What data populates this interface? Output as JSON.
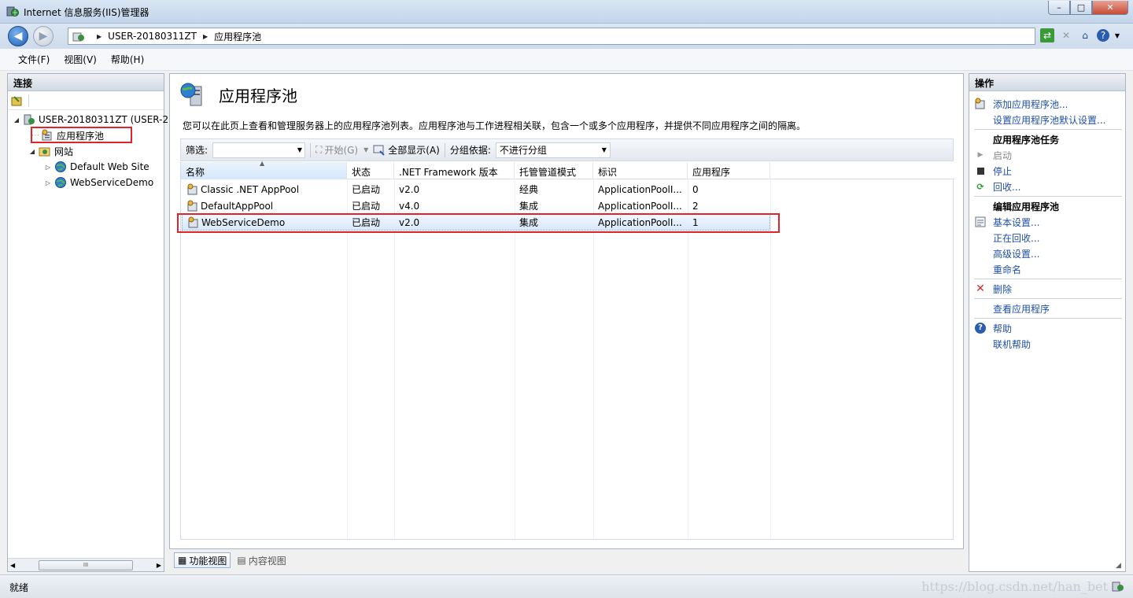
{
  "window": {
    "title": "Internet 信息服务(IIS)管理器",
    "controls": {
      "minimize": "–",
      "maximize": "□",
      "close": "✕"
    }
  },
  "address": {
    "crumbs": [
      "USER-20180311ZT",
      "应用程序池"
    ]
  },
  "menu": [
    "文件(F)",
    "视图(V)",
    "帮助(H)"
  ],
  "connections": {
    "header": "连接",
    "tree": [
      {
        "label": "USER-20180311ZT (USER-2",
        "level": 0,
        "twisty": "◢",
        "icon": "server-icon"
      },
      {
        "label": "应用程序池",
        "level": 1,
        "twisty": "",
        "icon": "app-pool-icon"
      },
      {
        "label": "网站",
        "level": 1,
        "twisty": "◢",
        "icon": "sites-folder-icon"
      },
      {
        "label": "Default Web Site",
        "level": 2,
        "twisty": "▷",
        "icon": "globe-icon"
      },
      {
        "label": "WebServiceDemo",
        "level": 2,
        "twisty": "▷",
        "icon": "globe-icon"
      }
    ],
    "scroll_left": "◀",
    "scroll_thumb": "III",
    "scroll_right": "▶"
  },
  "page": {
    "title": "应用程序池",
    "description": "您可以在此页上查看和管理服务器上的应用程序池列表。应用程序池与工作进程相关联，包含一个或多个应用程序，并提供不同应用程序之间的隔离。"
  },
  "filterbar": {
    "filter_label": "筛选:",
    "filter_value": "",
    "go_label": "开始(G)",
    "show_all_label": "全部显示(A)",
    "group_by_label": "分组依据:",
    "group_by_value": "不进行分组"
  },
  "grid": {
    "columns": [
      "名称",
      "状态",
      ".NET Framework 版本",
      "托管管道模式",
      "标识",
      "应用程序"
    ],
    "rows": [
      [
        "Classic .NET AppPool",
        "已启动",
        "v2.0",
        "经典",
        "ApplicationPoolI...",
        "0"
      ],
      [
        "DefaultAppPool",
        "已启动",
        "v4.0",
        "集成",
        "ApplicationPoolI...",
        "2"
      ],
      [
        "WebServiceDemo",
        "已启动",
        "v2.0",
        "集成",
        "ApplicationPoolI...",
        "1"
      ]
    ],
    "selected_row": 2
  },
  "view_tabs": [
    "功能视图",
    "内容视图"
  ],
  "actions": {
    "header": "操作",
    "items": [
      {
        "type": "link",
        "label": "添加应用程序池...",
        "icon": "add-pool-icon"
      },
      {
        "type": "link",
        "label": "设置应用程序池默认设置...",
        "icon": ""
      },
      {
        "type": "heading",
        "label": "应用程序池任务"
      },
      {
        "type": "disabled",
        "label": "启动",
        "icon": "play-icon"
      },
      {
        "type": "link",
        "label": "停止",
        "icon": "stop-icon"
      },
      {
        "type": "link",
        "label": "回收...",
        "icon": "recycle-icon"
      },
      {
        "type": "heading",
        "label": "编辑应用程序池"
      },
      {
        "type": "link",
        "label": "基本设置...",
        "icon": "settings-icon"
      },
      {
        "type": "link",
        "label": "正在回收...",
        "icon": ""
      },
      {
        "type": "link",
        "label": "高级设置...",
        "icon": ""
      },
      {
        "type": "link",
        "label": "重命名",
        "icon": ""
      },
      {
        "type": "link",
        "label": "删除",
        "icon": "delete-icon"
      },
      {
        "type": "link",
        "label": "查看应用程序",
        "icon": ""
      },
      {
        "type": "link",
        "label": "帮助",
        "icon": "help-icon"
      },
      {
        "type": "link",
        "label": "联机帮助",
        "icon": ""
      }
    ]
  },
  "status": {
    "text": "就绪",
    "watermark": "https://blog.csdn.net/han_bet"
  },
  "colors": {
    "link": "#1f4fa8",
    "annotation": "#e0242b",
    "selection": "#d8e8fb"
  }
}
